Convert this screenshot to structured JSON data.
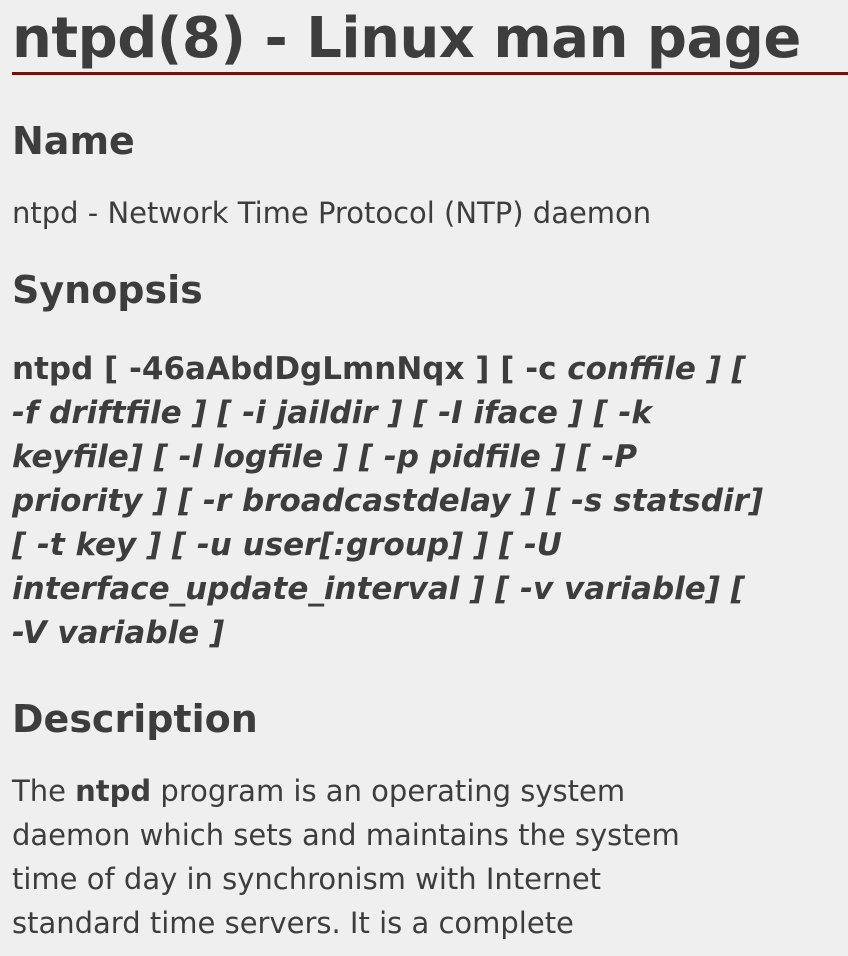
{
  "page": {
    "title": "ntpd(8) - Linux man page"
  },
  "sections": {
    "name": {
      "heading": "Name",
      "text": "ntpd - Network Time Protocol (NTP) daemon"
    },
    "synopsis": {
      "heading": "Synopsis",
      "lines": [
        {
          "bold": "ntpd [ -46aAbdDgLmnNqx ] [ -c ",
          "italic": "conffile ] ["
        },
        {
          "bold": "",
          "italic": "-f driftfile ] [ -i jaildir ] [ -I iface ] [ -k"
        },
        {
          "bold": "",
          "italic": "keyfile] [ -l logfile ] [ -p pidfile ] [ -P"
        },
        {
          "bold": "",
          "italic": "priority ] [ -r broadcastdelay ] [ -s statsdir]"
        },
        {
          "bold": "",
          "italic": "[ -t key ] [ -u user[:group] ] [ -U"
        },
        {
          "bold": "",
          "italic": "interface_update_interval ] [ -v variable] ["
        },
        {
          "bold": "",
          "italic": "-V variable ]"
        }
      ]
    },
    "description": {
      "heading": "Description",
      "line1_pre": "The ",
      "line1_bold": "ntpd",
      "line1_post": " program is an operating system",
      "line2": "daemon which sets and maintains the system",
      "line3": "time of day in synchronism with Internet",
      "line4": "standard time servers. It is a complete"
    }
  }
}
